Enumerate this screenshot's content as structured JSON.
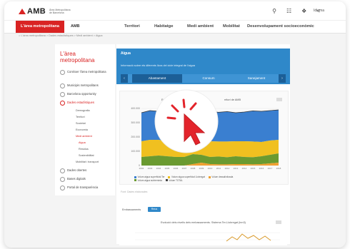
{
  "header": {
    "brand": "AMB",
    "brand_sub": "Àrea Metropolitana de Barcelona",
    "lang": "Idioma",
    "icons": [
      "search-icon",
      "apps-icon",
      "tools-icon",
      "share-icon"
    ]
  },
  "nav": {
    "active": "L'àrea metropolitana",
    "amb": "AMB",
    "items": [
      "Territori",
      "Habitatge",
      "Medi ambient",
      "Mobilitat",
      "Desenvolupament socioeconòmic"
    ]
  },
  "breadcrumb": "L'àrea metropolitana  >  Dades estadístiques  >  Medi ambient  >  Aigua",
  "sidebar": {
    "title": "L'àrea metropolitana",
    "items": [
      {
        "label": "Conèixer l'àrea metropolitana"
      },
      {
        "label": "Municipis metropolitans"
      },
      {
        "label": "Barcelona opportunity"
      },
      {
        "label": "Dades estadístiques"
      },
      {
        "label": "Dades obertes"
      },
      {
        "label": "Bases digitals"
      },
      {
        "label": "Portal de transparència"
      }
    ],
    "subitems": [
      "Demografia",
      "Territori",
      "Societat",
      "Economia",
      "Medi ambient",
      "Aigua",
      "Residus",
      "Sostenibilitat",
      "Mobilitat i transport"
    ]
  },
  "panel": {
    "title": "Aigua",
    "description": "Informació sobre els diferents llocs del cicle integral de l'aigua",
    "tabs": [
      "Abastament",
      "Consum",
      "Sanejament"
    ],
    "active_tab": "Abastament"
  },
  "chart": {
    "title_left": "Evo",
    "title_right": "rritori de AMB",
    "legend": [
      {
        "label": "Volum aigua superficial Ter",
        "color": "#3a7fd0"
      },
      {
        "label": "Volum aigua superficial Llobregat",
        "color": "#f0c020"
      },
      {
        "label": "Volum dessalinitzada",
        "color": "#f0a030"
      },
      {
        "label": "Volum aigua subterrània",
        "color": "#6a9a30"
      },
      {
        "label": "Volum TOTAL",
        "color": "#444444"
      }
    ],
    "source": "Font: Dades elaborades"
  },
  "chart2": {
    "label": "Embassaments",
    "button": "Reus",
    "title": "Evolució dels nivells dels embassaments. Sistema Ter-Llobregat (hm3)"
  },
  "chart_data": {
    "type": "area",
    "x": [
      "2002",
      "2003",
      "2004",
      "2005",
      "2006",
      "2007",
      "2008",
      "2009",
      "2010",
      "2011",
      "2012",
      "2013",
      "2014",
      "2015",
      "2016",
      "2017",
      "2018"
    ],
    "yticks": [
      "0",
      "100.000",
      "200.000",
      "300.000",
      "400.000"
    ],
    "series": [
      {
        "name": "Volum aigua superficial Ter",
        "values": [
          200000,
          205000,
          200000,
          190000,
          185000,
          190000,
          160000,
          200000,
          210000,
          205000,
          210000,
          200000,
          205000,
          215000,
          215000,
          210000,
          210000
        ]
      },
      {
        "name": "Volum aigua superficial Llobregat",
        "values": [
          110000,
          115000,
          110000,
          105000,
          100000,
          95000,
          80000,
          100000,
          110000,
          105000,
          110000,
          105000,
          110000,
          110000,
          100000,
          100000,
          95000
        ]
      },
      {
        "name": "Volum aigua subterrània",
        "values": [
          60000,
          65000,
          70000,
          65000,
          60000,
          60000,
          70000,
          55000,
          50000,
          55000,
          50000,
          55000,
          50000,
          50000,
          55000,
          60000,
          65000
        ]
      },
      {
        "name": "Volum dessalinitzada",
        "values": [
          0,
          0,
          0,
          0,
          0,
          0,
          10000,
          20000,
          10000,
          8000,
          8000,
          10000,
          10000,
          8000,
          10000,
          15000,
          20000
        ]
      }
    ],
    "ylim": [
      0,
      400000
    ]
  }
}
